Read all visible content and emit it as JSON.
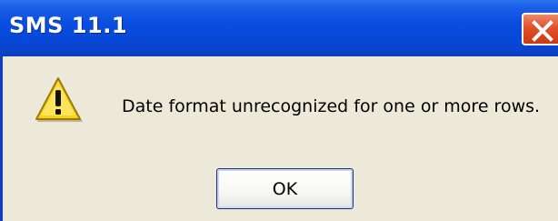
{
  "window": {
    "title": "SMS 11.1",
    "close_icon": "close-icon"
  },
  "dialog": {
    "icon": "warning-icon",
    "message": "Date format unrecognized for one or more rows.",
    "ok_label": "OK"
  },
  "colors": {
    "titlebar": "#0848d8",
    "close_button": "#e0502a",
    "client_background": "#ece9d8",
    "warning_yellow": "#f7d21c"
  }
}
